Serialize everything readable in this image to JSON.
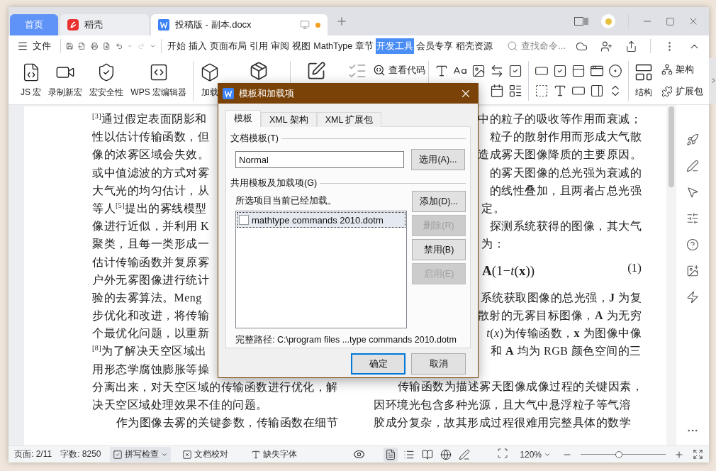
{
  "window": {
    "tabs": [
      {
        "label": "首页",
        "kind": "home",
        "selected": false,
        "unsaved": false
      },
      {
        "label": "稻壳",
        "kind": "docer",
        "selected": false,
        "unsaved": false
      },
      {
        "label": "投稿版 - 副本.docx",
        "kind": "doc",
        "selected": true,
        "unsaved": true
      }
    ]
  },
  "menu": {
    "file": "文件",
    "tabs": [
      {
        "label": "开始",
        "selected": false
      },
      {
        "label": "插入",
        "selected": false
      },
      {
        "label": "页面布局",
        "selected": false
      },
      {
        "label": "引用",
        "selected": false
      },
      {
        "label": "审阅",
        "selected": false
      },
      {
        "label": "视图",
        "selected": false
      },
      {
        "label": "MathType",
        "selected": false
      },
      {
        "label": "章节",
        "selected": false
      },
      {
        "label": "开发工具",
        "selected": true
      },
      {
        "label": "会员专享",
        "selected": false
      },
      {
        "label": "稻壳资源",
        "selected": false
      }
    ],
    "search": {
      "placeholder": "查找命令..."
    }
  },
  "ribbon": {
    "macros": [
      "JS 宏",
      "录制新宏",
      "宏安全性",
      "WPS 宏编辑器"
    ],
    "addins": "加载",
    "view_code": "查看代码",
    "structure": "结构",
    "schema": "架构",
    "expansion_pack": "扩展包"
  },
  "document": {
    "columns": [
      {
        "lines": [
          {
            "kind": "line",
            "text": "$^{[3]}$通过假定表面阴影和"
          },
          {
            "kind": "line",
            "text": "性以估计传输函数，但"
          },
          {
            "kind": "line",
            "text": "像的浓雾区域会失效。"
          },
          {
            "kind": "line",
            "text": "或中值滤波的方式对雾"
          },
          {
            "kind": "line",
            "text": "大气光的均匀估计，从"
          },
          {
            "kind": "line",
            "text": "等人$^{[5]}$提出的雾线模型"
          },
          {
            "kind": "line",
            "text": "像进行近似，并利用 K"
          },
          {
            "kind": "line",
            "text": "聚类，且每一类形成一"
          },
          {
            "kind": "line",
            "text": "估计传输函数并复原雾"
          },
          {
            "kind": "line",
            "text": "户外无雾图像进行统计"
          },
          {
            "kind": "line",
            "text": "验的去雾算法。Meng"
          },
          {
            "kind": "line",
            "text": "步优化和改进，将传输"
          },
          {
            "kind": "line",
            "text": "个最优化问题，以重新"
          },
          {
            "kind": "line",
            "text": "$^{[8]}$为了解决天空区域出"
          },
          {
            "kind": "line",
            "text": "用形态学腐蚀膨胀等操"
          },
          {
            "kind": "line",
            "text": "分离出来，对天空区域的传输函数进行优化，解"
          },
          {
            "kind": "line",
            "text": "决天空区域处理效果不佳的问题。"
          },
          {
            "kind": "indent",
            "text": "作为图像去雾的关键参数，传输函数在细节"
          }
        ]
      },
      {
        "lines": [
          {
            "kind": "cut",
            "text": "中的粒子的吸收等作用而衰减；"
          },
          {
            "kind": "cut",
            "text": "粒子的散射作用而形成大气散"
          },
          {
            "kind": "cut",
            "text": "造成雾天图像降质的主要原因。"
          },
          {
            "kind": "cut",
            "text": "的雾天图像的总光强为衰减的"
          },
          {
            "kind": "cut",
            "text": "的线性叠加，且两者占总光强"
          },
          {
            "kind": "tail",
            "text": "定。"
          },
          {
            "kind": "cut",
            "text": "探测系统获得的图像，其大气"
          },
          {
            "kind": "tail",
            "text": "为："
          },
          {
            "kind": "equation",
            "text": "**A**(1−*t*(**x**))",
            "number": "(1)"
          },
          {
            "kind": "cut",
            "text": "系统获取图像的总光强，**J** 为复"
          },
          {
            "kind": "cut",
            "text": "散射的无雾目标图像，**A** 为无穷"
          },
          {
            "kind": "cut",
            "text": "*t*(*x*)为传输函数，**x** 为图像中像"
          },
          {
            "kind": "cut",
            "text": "和 **A** 均为 RGB 颜色空间的三"
          },
          {
            "kind": "para",
            "text": "传输函数为描述雾天图像成像过程的关键因素，"
          },
          {
            "kind": "line",
            "text": "因环境光包含多种光源，且大气中悬浮粒子等气溶"
          },
          {
            "kind": "line",
            "text": "胶成分复杂，故其形成过程很难用完整具体的数学"
          }
        ]
      }
    ]
  },
  "dialog": {
    "title": "模板和加载项",
    "tabs": [
      {
        "label": "模板",
        "selected": true
      },
      {
        "label": "XML 架构",
        "selected": false
      },
      {
        "label": "XML 扩展包",
        "selected": false
      }
    ],
    "template_section": "文档模板(T)",
    "template_field": {
      "value": "Normal"
    },
    "attach_button": "选用(A)...",
    "global_section": "共用模板及加载项(G)",
    "loaded_note": "所选项目当前已经加载。",
    "addins": [
      {
        "label": "mathtype commands 2010.dotm",
        "checked": false,
        "selected": true
      }
    ],
    "side_buttons": [
      {
        "label": "添加(D)...",
        "disabled": false
      },
      {
        "label": "删除(R)",
        "disabled": true
      },
      {
        "label": "禁用(B)",
        "disabled": false
      },
      {
        "label": "启用(E)",
        "disabled": true
      }
    ],
    "full_path": "完整路径: C:\\program files ...type commands 2010.dotm",
    "buttons": [
      {
        "label": "确定",
        "default": true
      },
      {
        "label": "取消",
        "default": false
      }
    ]
  },
  "status_bar": {
    "page": "页面: 2/11",
    "words": "字数: 8250",
    "spell_check": "拼写检查",
    "proofread": "文档校对",
    "missing_fonts": "缺失字体",
    "views": [
      {
        "kind": "page",
        "selected": true
      },
      {
        "kind": "outline",
        "selected": false
      },
      {
        "kind": "reading",
        "selected": false
      },
      {
        "kind": "web",
        "selected": false
      },
      {
        "kind": "write",
        "selected": false
      }
    ],
    "zoom": "120%",
    "zoom_slider": {
      "level": 0.45
    }
  }
}
